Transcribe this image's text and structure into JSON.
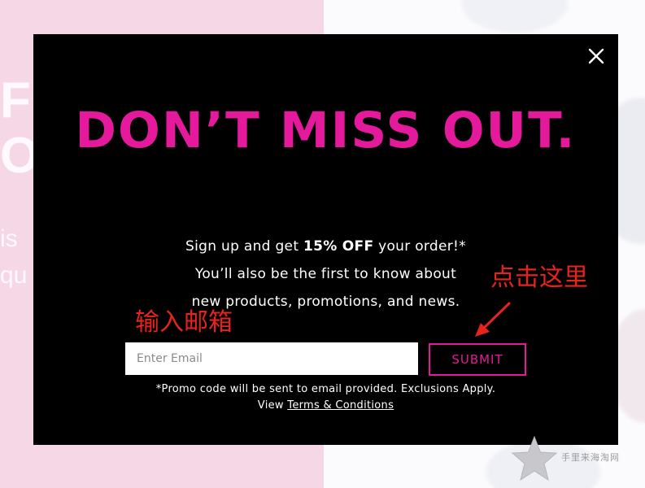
{
  "background_page": {
    "left_text_lines": [
      "F",
      "O",
      "is",
      "qu"
    ]
  },
  "modal": {
    "close_icon": "close-icon",
    "headline": "DON’T MISS OUT.",
    "copy": {
      "line1_pre": "Sign up and get ",
      "line1_bold": "15% OFF",
      "line1_post": " your order!*",
      "line2": "You’ll also be the first to know about",
      "line3": "new products, promotions, and news."
    },
    "email_placeholder": "Enter Email",
    "email_value": "",
    "submit_label": "SUBMIT",
    "fine_print": {
      "line1": "*Promo code will be sent to email provided. Exclusions Apply.",
      "line2_pre": "View ",
      "terms_link": "Terms & Conditions"
    }
  },
  "annotations": {
    "email_hint": "输入邮箱",
    "submit_hint": "点击这里",
    "arrow_icon": "arrow-icon"
  },
  "watermark": {
    "text": "手里来海淘网",
    "icon": "star-icon"
  },
  "colors": {
    "accent_pink": "#e5199b",
    "modal_bg": "#000000",
    "annotation_red": "#e8231e",
    "bg_pink": "#f6d7e6"
  }
}
